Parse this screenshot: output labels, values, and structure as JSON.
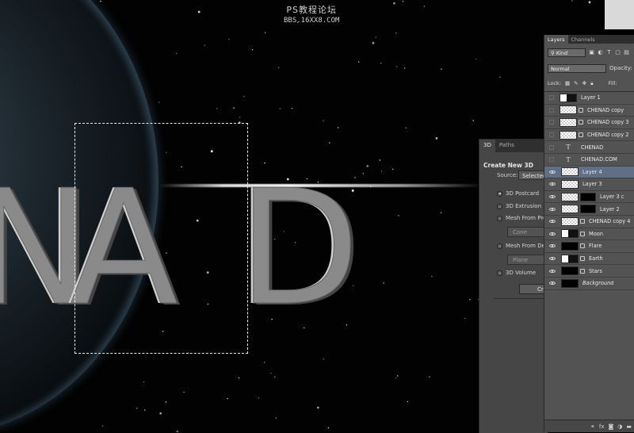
{
  "watermark": {
    "line1": "PS教程论坛",
    "line2": "BBS.16XX8.COM"
  },
  "canvas": {
    "letters": [
      "A",
      "D"
    ],
    "accent_colors": {
      "space": "#020202",
      "letter_gray": "#8a8a8a",
      "selection": "#e8e8e8"
    }
  },
  "panel3d": {
    "tabs": [
      {
        "label": "3D",
        "active": true
      },
      {
        "label": "Paths",
        "active": false
      }
    ],
    "title": "Create New 3D",
    "source_label": "Source:",
    "source_value": "Selected",
    "options": [
      {
        "label": "3D Postcard",
        "checked": true
      },
      {
        "label": "3D Extrusion",
        "checked": false
      },
      {
        "label": "Mesh From Pre",
        "checked": false
      },
      {
        "label": "Mesh From Dep",
        "checked": false
      },
      {
        "label": "3D Volume",
        "checked": false
      }
    ],
    "cone_select": "Cone",
    "plane_select": "Plane",
    "create_button": "Cr"
  },
  "layers_panel": {
    "tabs": [
      {
        "label": "Layers",
        "active": true
      },
      {
        "label": "Channels",
        "active": false
      }
    ],
    "kind_label": "Kind",
    "blend_mode": "Normal",
    "opacity_label": "Opacity:",
    "lock_label": "Lock:",
    "fill_label": "Fill:",
    "layers": [
      {
        "name": "Layer 1",
        "visible": false,
        "thumb": "mixed",
        "smart": false,
        "mask": false,
        "selected": false,
        "italic": false
      },
      {
        "name": "CHENAD copy",
        "visible": false,
        "thumb": "transparent",
        "smart": true,
        "mask": false,
        "selected": false,
        "italic": false
      },
      {
        "name": "CHENAD copy 3",
        "visible": false,
        "thumb": "transparent",
        "smart": true,
        "mask": false,
        "selected": false,
        "italic": false
      },
      {
        "name": "CHENAD copy 2",
        "visible": false,
        "thumb": "transparent",
        "smart": true,
        "mask": false,
        "selected": false,
        "italic": false
      },
      {
        "name": "CHENAD",
        "visible": false,
        "thumb": "text",
        "smart": false,
        "mask": false,
        "selected": false,
        "italic": false
      },
      {
        "name": "CHENAD.COM",
        "visible": false,
        "thumb": "text",
        "smart": false,
        "mask": false,
        "selected": false,
        "italic": false
      },
      {
        "name": "Layer 4",
        "visible": true,
        "thumb": "transparent",
        "smart": false,
        "mask": false,
        "selected": true,
        "italic": false
      },
      {
        "name": "Layer 3",
        "visible": true,
        "thumb": "transparent",
        "smart": false,
        "mask": false,
        "selected": false,
        "italic": false
      },
      {
        "name": "Layer 3 c",
        "visible": true,
        "thumb": "transparent",
        "smart": false,
        "mask": true,
        "selected": false,
        "italic": false
      },
      {
        "name": "Layer 2",
        "visible": true,
        "thumb": "transparent",
        "smart": false,
        "mask": true,
        "selected": false,
        "italic": false
      },
      {
        "name": "CHENAD copy 4",
        "visible": true,
        "thumb": "transparent",
        "smart": true,
        "mask": false,
        "selected": false,
        "italic": false
      },
      {
        "name": "Moon",
        "visible": true,
        "thumb": "mixed",
        "smart": true,
        "mask": false,
        "selected": false,
        "italic": false
      },
      {
        "name": "Flare",
        "visible": true,
        "thumb": "black",
        "smart": true,
        "mask": false,
        "selected": false,
        "italic": false
      },
      {
        "name": "Earth",
        "visible": true,
        "thumb": "mixed",
        "smart": true,
        "mask": false,
        "selected": false,
        "italic": false
      },
      {
        "name": "Stars",
        "visible": true,
        "thumb": "black",
        "smart": true,
        "mask": false,
        "selected": false,
        "italic": false
      },
      {
        "name": "Background",
        "visible": true,
        "thumb": "black",
        "smart": false,
        "mask": false,
        "selected": false,
        "italic": true
      }
    ],
    "bottom_icons": [
      "link-icon",
      "fx-icon",
      "mask-icon",
      "adjustment-icon",
      "folder-icon"
    ],
    "bottom_fx_label": "fx"
  }
}
